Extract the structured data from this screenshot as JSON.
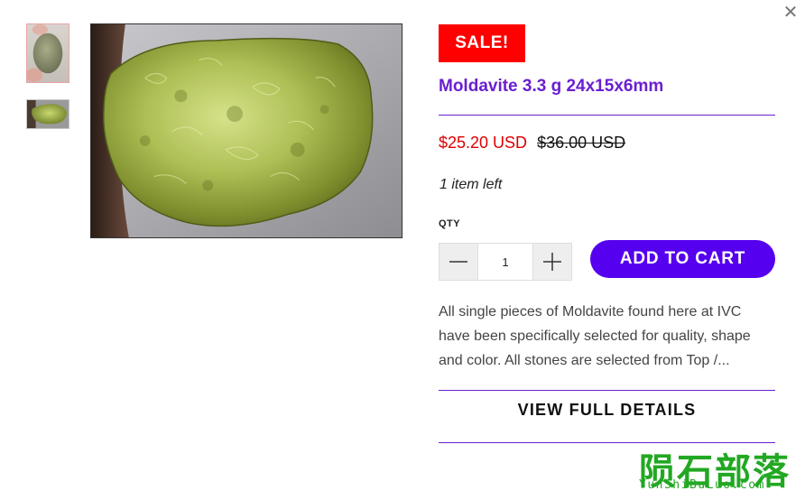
{
  "close_icon": "close-icon",
  "thumbnails": [
    {
      "alt": "moldavite-thumbnail-1",
      "icon": "image-thumbnail"
    },
    {
      "alt": "moldavite-thumbnail-2",
      "icon": "image-thumbnail"
    }
  ],
  "product": {
    "badge": "SALE!",
    "title": "Moldavite 3.3 g 24x15x6mm",
    "price_sale": "$25.20 USD",
    "price_compare": "$36.00 USD",
    "stock_note": "1 item left",
    "qty_label": "QTY",
    "qty_value": "1",
    "add_to_cart_label": "ADD TO CART",
    "description": "All single pieces of Moldavite found here at IVC have been specifically selected for quality, shape and color. All stones are selected from Top /...",
    "view_details_label": "VIEW FULL DETAILS"
  },
  "watermark": {
    "chars": "陨石部落",
    "url": "YunShiBuLuo.com"
  },
  "colors": {
    "accent": "#6a1fd0",
    "cart_button": "#5500ee",
    "sale_badge": "#ff0000",
    "sale_price": "#e10000",
    "watermark": "#22a822"
  }
}
